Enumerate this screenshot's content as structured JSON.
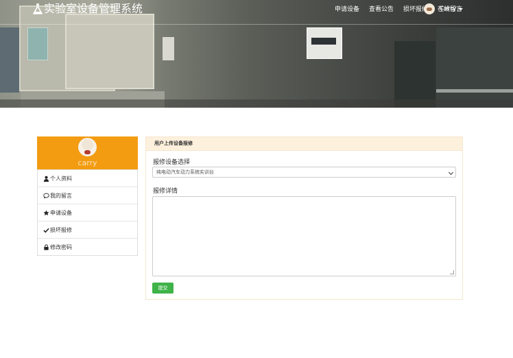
{
  "navbar": {
    "brand": "实验室设备管理系统",
    "links": [
      "申请设备",
      "查看公告",
      "损坏报修",
      "在线留言"
    ],
    "user_name": "Carry"
  },
  "sidebar": {
    "username": "carry",
    "items": [
      {
        "label": "个人资料",
        "icon": "user-icon"
      },
      {
        "label": "我的留言",
        "icon": "comment-icon"
      },
      {
        "label": "申请设备",
        "icon": "star-icon"
      },
      {
        "label": "损坏报修",
        "icon": "check-icon"
      },
      {
        "label": "修改密码",
        "icon": "lock-icon"
      }
    ]
  },
  "form": {
    "header": "用户上传设备报修",
    "device_label": "报修设备选择",
    "device_value": "纯电动汽车动力系统实训台",
    "detail_label": "报修详情",
    "detail_value": "",
    "submit_label": "提交"
  },
  "colors": {
    "profile_bg": "#f39c12",
    "submit_bg": "#3fb349",
    "panel_header_bg": "#fdf0dc"
  }
}
